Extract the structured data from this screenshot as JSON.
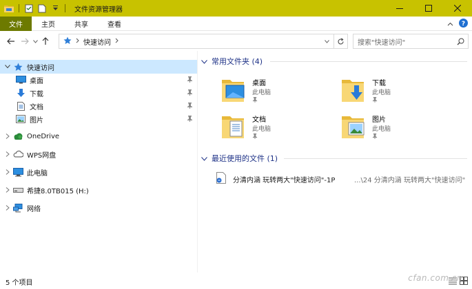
{
  "window": {
    "title": "文件资源管理器"
  },
  "ribbon": {
    "tabs": [
      "文件",
      "主页",
      "共享",
      "查看"
    ]
  },
  "address": {
    "path": "快速访问",
    "search_placeholder": "搜索\"快速访问\""
  },
  "nav": {
    "quick_access": "快速访问",
    "pinned": [
      "桌面",
      "下载",
      "文档",
      "图片"
    ],
    "onedrive": "OneDrive",
    "wps": "WPS网盘",
    "this_pc": "此电脑",
    "drive": "希捷8.0TB015 (H:)",
    "network": "网络"
  },
  "frequent": {
    "header": "常用文件夹 (4)",
    "items": [
      {
        "name": "桌面",
        "location": "此电脑"
      },
      {
        "name": "下载",
        "location": "此电脑"
      },
      {
        "name": "文档",
        "location": "此电脑"
      },
      {
        "name": "图片",
        "location": "此电脑"
      }
    ]
  },
  "recent": {
    "header": "最近使用的文件 (1)",
    "items": [
      {
        "name": "分清内涵  玩转两大\"快速访问\"-1P",
        "path": "...\\24 分清内涵  玩转两大\"快速访问\""
      }
    ]
  },
  "status": {
    "count": "5 个项目"
  },
  "watermark": "cfan.com.cn",
  "colors": {
    "titlebar": "#c8c200",
    "file_tab": "#6d7a00",
    "selection": "#cce8ff",
    "section_header": "#1e3287"
  }
}
